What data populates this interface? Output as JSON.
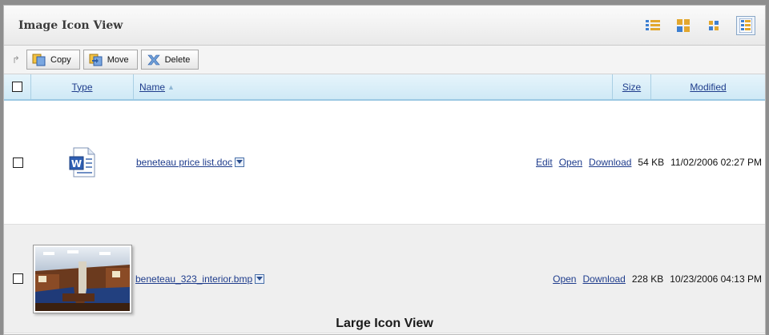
{
  "header": {
    "title": "Image Icon View"
  },
  "toolbar": {
    "copy_label": "Copy",
    "move_label": "Move",
    "delete_label": "Delete"
  },
  "columns": {
    "type": "Type",
    "name": "Name",
    "size": "Size",
    "modified": "Modified"
  },
  "files": [
    {
      "name": "beneteau price list.doc",
      "actions": [
        "Edit",
        "Open",
        "Download"
      ],
      "size": "54 KB",
      "modified": "11/02/2006 02:27 PM",
      "icon": "word-document-icon"
    },
    {
      "name": "beneteau_323_interior.bmp",
      "actions": [
        "Open",
        "Download"
      ],
      "size": "228 KB",
      "modified": "10/23/2006 04:13 PM",
      "icon": "image-thumbnail"
    }
  ],
  "caption": "Large Icon View",
  "colors": {
    "accent_blue": "#1e3c8c",
    "column_header_bg": "#d8eef9",
    "row_alt_bg": "#efefef"
  }
}
